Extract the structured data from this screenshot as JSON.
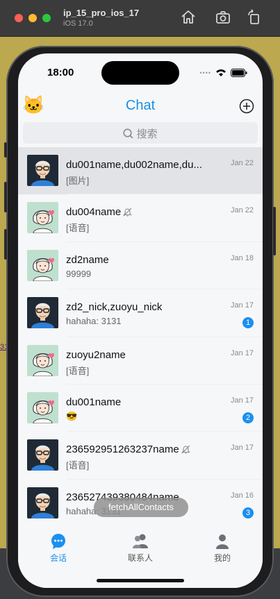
{
  "window": {
    "title": "ip_15_pro_ios_17",
    "subtitle": "iOS 17.0"
  },
  "desktop_link": "31",
  "status": {
    "time": "18:00"
  },
  "header": {
    "title": "Chat",
    "avatar_icon": "cat-emoji",
    "add_icon": "plus-circle-icon"
  },
  "search": {
    "placeholder": "搜索"
  },
  "conversations": [
    {
      "name": "du001name,du002name,du...",
      "last_message": "[图片]",
      "date": "Jan 22",
      "muted": false,
      "unread": "",
      "avatar": "male",
      "selected": true
    },
    {
      "name": "du004name",
      "last_message": "[语音]",
      "date": "Jan 22",
      "muted": true,
      "unread": "",
      "avatar": "female"
    },
    {
      "name": "zd2name",
      "last_message": "99999",
      "date": "Jan 18",
      "muted": false,
      "unread": "",
      "avatar": "female"
    },
    {
      "name": "zd2_nick,zuoyu_nick",
      "last_message": "hahaha: 3131",
      "date": "Jan 17",
      "muted": false,
      "unread": "1",
      "avatar": "male"
    },
    {
      "name": "zuoyu2name",
      "last_message": "[语音]",
      "date": "Jan 17",
      "muted": false,
      "unread": "",
      "avatar": "female"
    },
    {
      "name": "du001name",
      "last_message": "😎",
      "date": "Jan 17",
      "muted": false,
      "unread": "2",
      "avatar": "female"
    },
    {
      "name": "236592951263237name",
      "last_message": "[语音]",
      "date": "Jan 17",
      "muted": true,
      "unread": "",
      "avatar": "male"
    },
    {
      "name": "236527439380484name",
      "last_message": "hahaha: 3131",
      "date": "Jan 16",
      "muted": false,
      "unread": "3",
      "avatar": "male"
    }
  ],
  "toast": "fetchAllContacts",
  "tabbar": {
    "items": [
      {
        "label": "会话",
        "active": true
      },
      {
        "label": "联系人",
        "active": false
      },
      {
        "label": "我的",
        "active": false
      }
    ]
  },
  "colors": {
    "accent": "#1a8ff0",
    "title": "#1a90e8",
    "badge": "#1a8ff0"
  }
}
